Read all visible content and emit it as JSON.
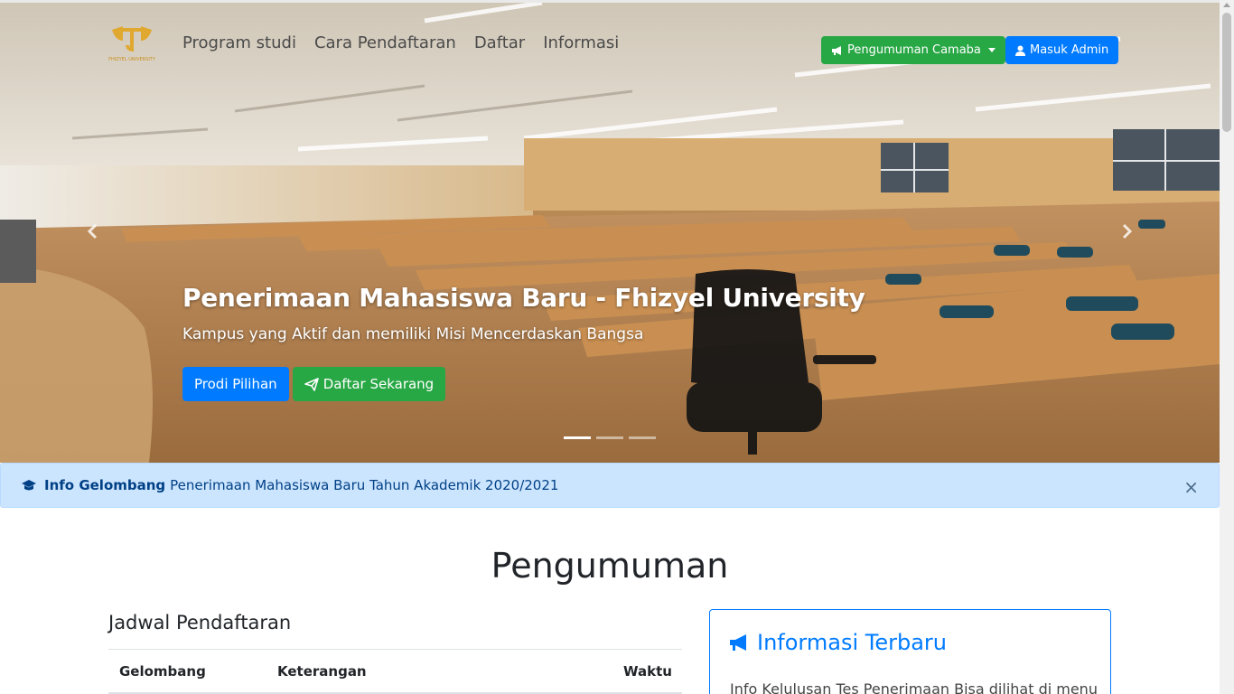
{
  "nav": {
    "logo_text": "FHIZYEL UNIVERSITY",
    "links": [
      "Program studi",
      "Cara Pendaftaran",
      "Daftar",
      "Informasi"
    ],
    "announcement_button": "Pengumuman Camaba",
    "admin_button": "Masuk Admin"
  },
  "hero": {
    "title": "Penerimaan Mahasiswa Baru - Fhizyel University",
    "subtitle": "Kampus yang Aktif dan memiliki Misi Mencerdaskan Bangsa",
    "primary_button": "Prodi Pilihan",
    "secondary_button": "Daftar Sekarang",
    "slide_count": 3,
    "active_slide": 1
  },
  "alert": {
    "label": "Info Gelombang",
    "text": "Penerimaan Mahasiswa Baru Tahun Akademik 2020/2021",
    "close": "×"
  },
  "main": {
    "section_title": "Pengumuman",
    "schedule": {
      "title": "Jadwal Pendaftaran",
      "columns": [
        "Gelombang",
        "Keterangan",
        "Waktu"
      ]
    },
    "info_card": {
      "title": "Informasi Terbaru",
      "text": "Info Kelulusan Tes Penerimaan Bisa dilihat di menu"
    }
  },
  "colors": {
    "primary": "#007bff",
    "success": "#28a745",
    "alert_bg": "#cce5ff",
    "alert_text": "#004085"
  }
}
